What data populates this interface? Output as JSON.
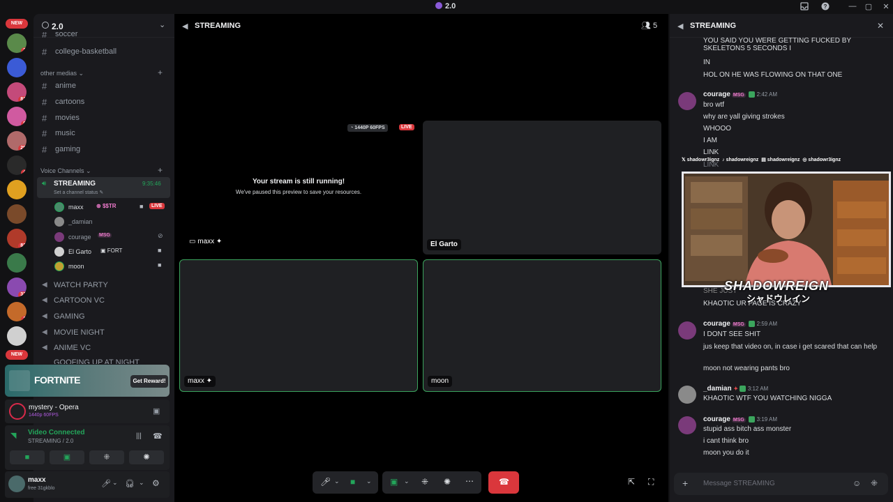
{
  "window": {
    "title": "2.0",
    "icon": "discord-icon"
  },
  "titlebar": {
    "icons": [
      "inbox-icon",
      "help-icon",
      "minimize-icon",
      "maximize-icon",
      "close-icon"
    ]
  },
  "servers": {
    "new_top": "NEW",
    "new_bottom": "NEW",
    "badges": [
      {
        "label": "2",
        "color": "#5a8a4a"
      },
      {
        "label": "",
        "color": "#3b5bd6"
      },
      {
        "label": "81",
        "color": "#c44a7a"
      },
      {
        "label": "8",
        "color": "#d05aa0"
      },
      {
        "label": "25",
        "color": "#b06a6a"
      },
      {
        "label": "4",
        "color": "#2a2a2a"
      },
      {
        "label": "",
        "color": "#e0a020"
      },
      {
        "label": "",
        "color": "#7a4a2a"
      },
      {
        "label": "82",
        "color": "#b03a2a"
      },
      {
        "label": "",
        "color": "#3a7a4a"
      },
      {
        "label": "33",
        "color": "#8a4ab0"
      },
      {
        "label": "1",
        "color": "#c46a2a"
      },
      {
        "label": "",
        "color": "#d0d0d0"
      }
    ]
  },
  "guild": {
    "name": "2.0",
    "cut_channel": "soccer",
    "channels_top": [
      "college-basketball"
    ],
    "category_media": "other medias",
    "media_channels": [
      "anime",
      "cartoons",
      "movies",
      "music",
      "gaming"
    ],
    "category_voice": "Voice Channels",
    "active_voice": {
      "name": "STREAMING",
      "timer": "9:35:46",
      "status": "Set a channel status"
    },
    "voice_users": [
      {
        "name": "maxx",
        "tag": "$$TR",
        "live": "LIVE"
      },
      {
        "name": "_damian",
        "tag": ""
      },
      {
        "name": "courage",
        "tag": "MSG"
      },
      {
        "name": "El Garto",
        "tag": "FORT"
      },
      {
        "name": "moon",
        "tag": ""
      }
    ],
    "voice_channels": [
      "WATCH PARTY",
      "CARTOON VC",
      "GAMING",
      "MOVIE NIGHT",
      "ANIME VC",
      "GOOFING UP AT NIGHT"
    ]
  },
  "promo": {
    "logo": "FORTNITE",
    "button": "Get Reward!"
  },
  "activity": {
    "title": "mystery - Opera",
    "sub": "1440p 60FPS"
  },
  "voice_panel": {
    "status": "Video Connected",
    "location": "STREAMING / 2.0"
  },
  "user_panel": {
    "name": "maxx",
    "status": "free 31gkblo"
  },
  "main": {
    "channel": "STREAMING",
    "member_count": "5",
    "quality": "1440P 60FPS",
    "live": "LIVE",
    "paused_title": "Your stream is still running!",
    "paused_sub": "We've paused this preview to save your resources.",
    "tiles": [
      {
        "name": "maxx"
      },
      {
        "name": "El Garto"
      },
      {
        "name": "maxx"
      },
      {
        "name": "moon"
      }
    ]
  },
  "chat": {
    "title": "STREAMING",
    "messages": [
      {
        "line": "YOU SAID YOU WERE GETTING FUCKED BY SKELETONS 5 SECONDS I"
      },
      {
        "line": "IN"
      },
      {
        "line": "HOL ON HE WAS FLOWING ON THAT ONE"
      }
    ],
    "groups": [
      {
        "author": "courage",
        "tag": "MSG",
        "time": "2:42 AM",
        "lines": [
          "bro wtf",
          "why are yall giving strokes",
          "WHOOO",
          "I AM",
          "LINK",
          "LINK"
        ]
      },
      {
        "author": "courage",
        "tag": "MSG",
        "time": "2:59 AM",
        "lines": [
          "I DONT SEE SHIT",
          "jus keep that video on, in case i get scared that can help",
          "moon not wearing pants bro"
        ]
      },
      {
        "author": "_damian",
        "tag": "",
        "time": "3:12 AM",
        "lines": [
          "KHAOTIC WTF YOU WATCHING NIGGA"
        ]
      },
      {
        "author": "courage",
        "tag": "MSG",
        "time": "3:19 AM",
        "lines": [
          "stupid ass bitch ass monster",
          "i cant think bro",
          "moon you do it"
        ]
      }
    ],
    "hidden_lines": [
      "SHE JUST",
      "KHAOTIC UR PAGE IS CRAZY"
    ],
    "input_placeholder": "Message STREAMING"
  },
  "overlay": {
    "socials": [
      "shadowr3ignz",
      "shadowreignz",
      "shadowreignz",
      "shadowr3ignz"
    ],
    "brand": "SHADOWREIGN",
    "brand_jp": "シャドウレイン"
  }
}
